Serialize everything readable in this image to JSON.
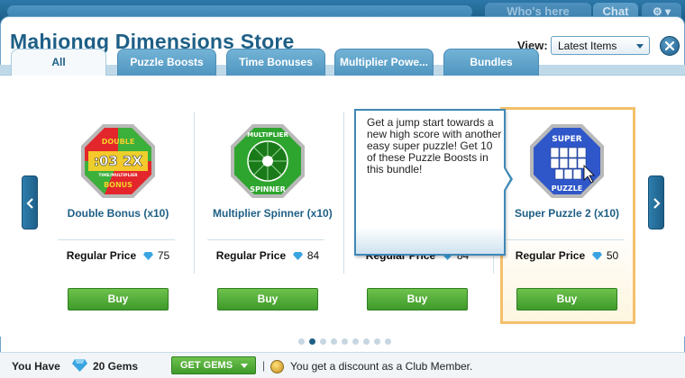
{
  "top_tabs": {
    "who": "Who's here",
    "chat": "Chat"
  },
  "window": {
    "title": "Mahjongg Dimensions Store"
  },
  "view": {
    "label": "View:",
    "selected": "Latest Items"
  },
  "tabs": [
    {
      "label": "All"
    },
    {
      "label": "Puzzle Boosts"
    },
    {
      "label": "Time Bonuses"
    },
    {
      "label": "Multiplier Powe..."
    },
    {
      "label": "Bundles"
    }
  ],
  "products": [
    {
      "name": "Double Bonus (x10)",
      "price_label": "Regular Price",
      "price": "75",
      "buy": "Buy",
      "icon": {
        "line1": "DOUBLE",
        "line2": ":03 2X",
        "line3": "TIME/MULTIPLIER",
        "line4": "BONUS",
        "colors": [
          "#e3262b",
          "#3bb03b",
          "#f5d12b"
        ]
      }
    },
    {
      "name": "Multiplier Spinner (x10)",
      "price_label": "Regular Price",
      "price": "84",
      "buy": "Buy",
      "icon": {
        "line1": "MULTIPLIER",
        "line2": "SPINNER",
        "colors": [
          "#2ea52e",
          "#1a7a1a",
          "#ffffff"
        ]
      }
    },
    {
      "name": "",
      "price_label": "Regular Price",
      "price": "84",
      "buy": "Buy"
    },
    {
      "name": "Super Puzzle 2 (x10)",
      "price_label": "Regular Price",
      "price": "50",
      "buy": "Buy",
      "icon": {
        "line1": "SUPER",
        "line2": "PUZZLE",
        "colors": [
          "#2f57c9",
          "#1c3a8f",
          "#ffffff"
        ]
      }
    }
  ],
  "tooltip": {
    "text": "Get a jump start towards a new high score with another easy super puzzle! Get 10 of these Puzzle Boosts in this bundle!"
  },
  "partial_price": "Regular Price",
  "partial_price_value": "84",
  "pagination": {
    "count": 9,
    "active": 1
  },
  "footer": {
    "you_have": "You Have",
    "gems": "20 Gems",
    "get_gems": "GET GEMS",
    "separator": "|",
    "discount": "You get a discount as a Club Member."
  }
}
